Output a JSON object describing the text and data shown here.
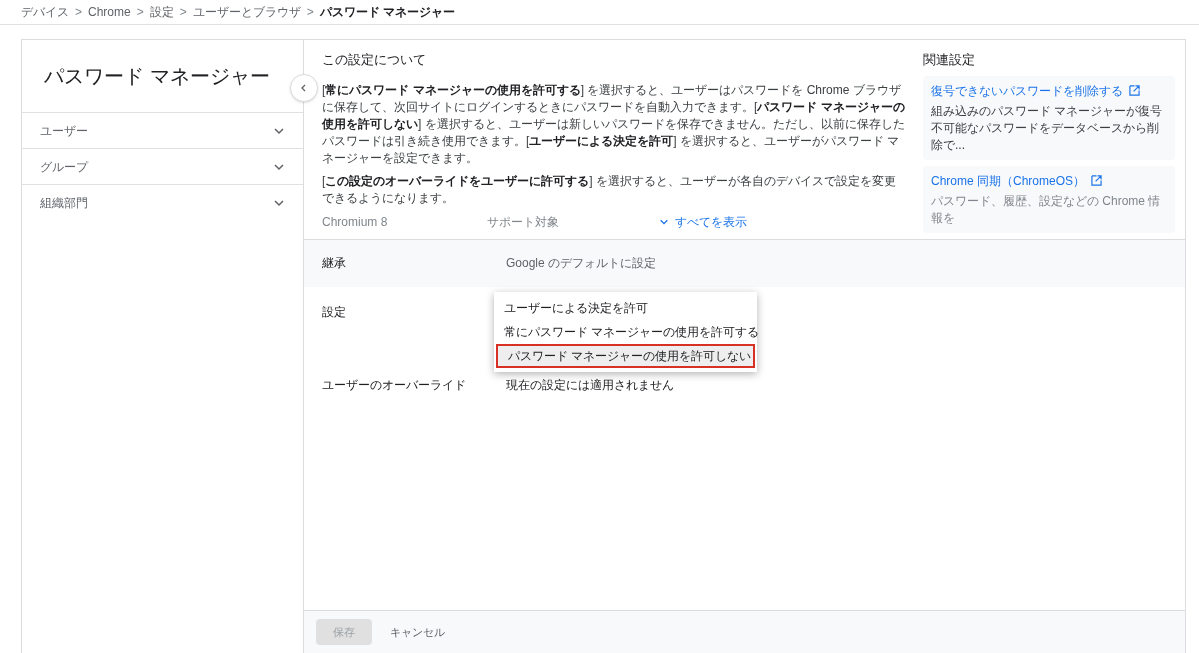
{
  "breadcrumb_separator": ">",
  "breadcrumb": [
    {
      "label": "デバイス"
    },
    {
      "label": "Chrome"
    },
    {
      "label": "設定"
    },
    {
      "label": "ユーザーとブラウザ"
    },
    {
      "label": "パスワード マネージャー"
    }
  ],
  "sidebar": {
    "title": "パスワード マネージャー",
    "sections": [
      {
        "label": "ユーザー",
        "expanded": false
      },
      {
        "label": "グループ",
        "expanded": false
      },
      {
        "label": "組織部門",
        "expanded": false
      }
    ]
  },
  "about": {
    "title": "この設定について",
    "paragraphs": [
      "[**常にパスワード マネージャーの使用を許可する**] を選択すると、ユーザーはパスワードを Chrome ブラウザに保存して、次回サイトにログインするときにパスワードを自動入力できます。[**パスワード マネージャーの使用を許可しない**] を選択すると、ユーザーは新しいパスワードを保存できません。ただし、以前に保存したパスワードは引き続き使用できます。[**ユーザーによる決定を許可**] を選択すると、ユーザーがパスワード マネージャーを設定できます。",
      "[**この設定のオーバーライドをユーザーに許可する**] を選択すると、ユーザーが各自のデバイスで設定を変更できるようになります。"
    ],
    "faded_cells": [
      "Chromium 8",
      "サポート対象"
    ],
    "show_all": "すべてを表示"
  },
  "related": {
    "title": "関連設定",
    "links": [
      {
        "title": "復号できないパスワードを削除する",
        "description": "組み込みのパスワード マネージャーが復号不可能なパスワードをデータベースから削除で..."
      },
      {
        "title": "Chrome 同期（ChromeOS）",
        "description": "パスワード、履歴、設定などの Chrome 情報を"
      }
    ]
  },
  "rows": [
    {
      "kind": "inherit",
      "label": "継承",
      "value": "Google のデフォルトに設定"
    },
    {
      "kind": "select",
      "label": "設定",
      "options": [
        {
          "label": "ユーザーによる決定を許可",
          "selected": false
        },
        {
          "label": "常にパスワード マネージャーの使用を許可する",
          "selected": false
        },
        {
          "label": "パスワード マネージャーの使用を許可しない",
          "selected": true
        }
      ]
    },
    {
      "kind": "text",
      "label": "ユーザーのオーバーライド",
      "value": "現在の設定には適用されません"
    }
  ],
  "footer": {
    "save": {
      "label": "保存",
      "disabled": true
    },
    "cancel": "キャンセル"
  }
}
